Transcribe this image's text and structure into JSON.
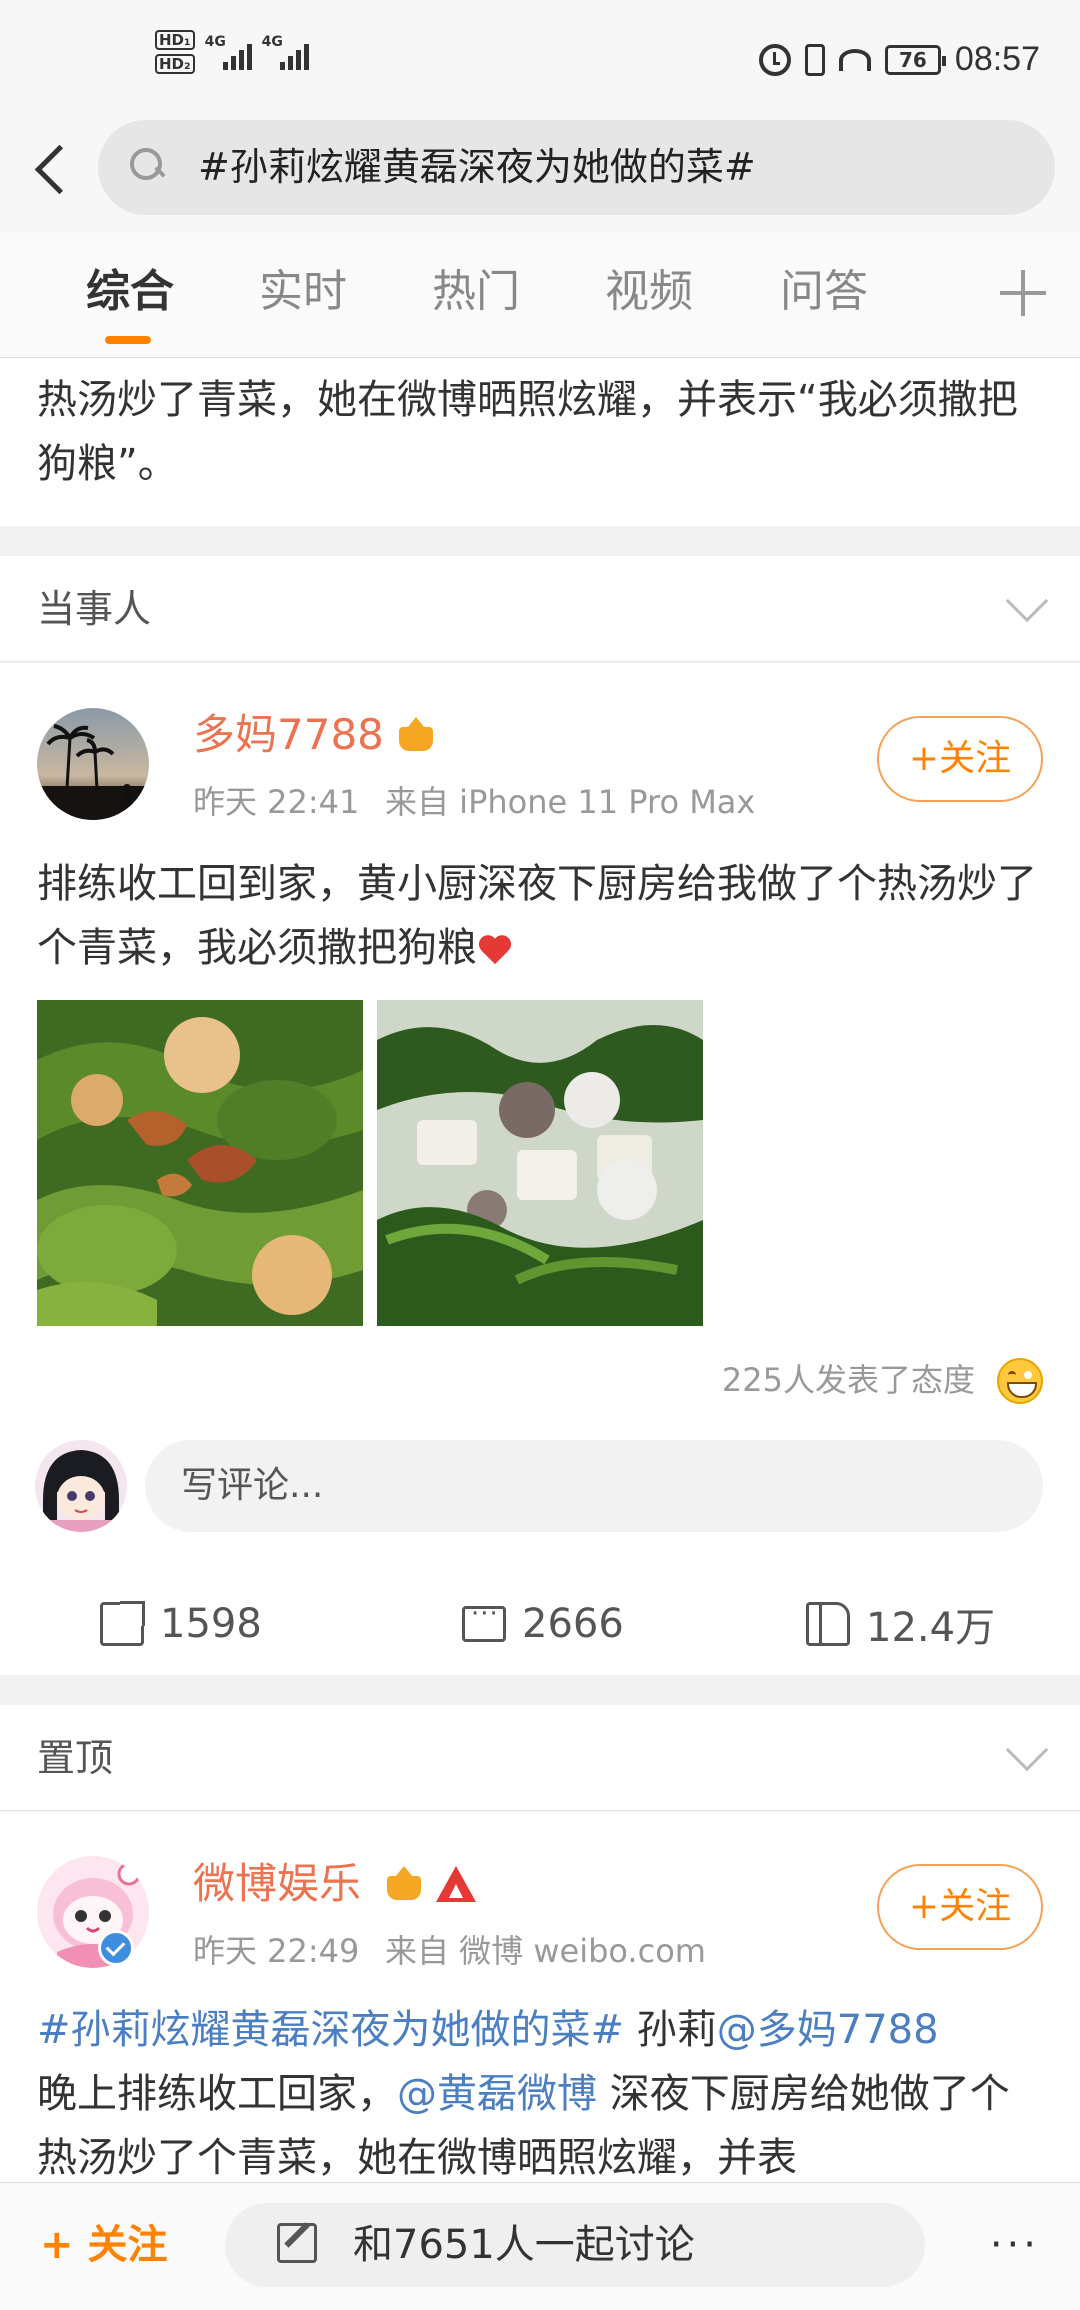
{
  "status_bar": {
    "hd1": "HD₁",
    "hd2": "HD₂",
    "net1": "4G",
    "net2": "4G",
    "battery": "76",
    "time": "08:57"
  },
  "search": {
    "query": "#孙莉炫耀黄磊深夜为她做的菜#"
  },
  "tabs": [
    {
      "label": "综合"
    },
    {
      "label": "实时"
    },
    {
      "label": "热门"
    },
    {
      "label": "视频"
    },
    {
      "label": "问答"
    }
  ],
  "prev_card": {
    "text": "热汤炒了青菜，她在微博晒照炫耀，并表示“我必须撒把狗粮”。"
  },
  "section_party": {
    "title": "当事人"
  },
  "post1": {
    "username": "多妈7788",
    "time": "昨天 22:41",
    "source": "来自 iPhone 11 Pro Max",
    "follow_label": "+关注",
    "text": "排练收工回到家，黄小厨深夜下厨房给我做了个热汤炒了个青菜，我必须撒把狗粮",
    "reactions_text": "225人发表了态度",
    "comment_placeholder": "写评论...",
    "reposts": "1598",
    "comments": "2666",
    "likes": "12.4万"
  },
  "section_pinned": {
    "title": "置顶"
  },
  "post2": {
    "username": "微博娱乐",
    "time": "昨天 22:49",
    "source": "来自 微博 weibo.com",
    "follow_label": "+关注",
    "hashtag": "#孙莉炫耀黄磊深夜为她做的菜#",
    "text_a": " 孙莉",
    "mention1": "@多妈7788",
    "text_b": "晚上排练收工回家，",
    "mention2": "@黄磊微博",
    "text_c": " 深夜下厨房给她做了个热汤炒了个青菜，她在微博晒照炫耀，并表"
  },
  "bottom_bar": {
    "follow_label": "+ 关注",
    "discuss_label": "和7651人一起讨论",
    "more": "···"
  },
  "colors": {
    "accent": "#ff8200",
    "username": "#eb7350",
    "link": "#4b7fc2"
  }
}
